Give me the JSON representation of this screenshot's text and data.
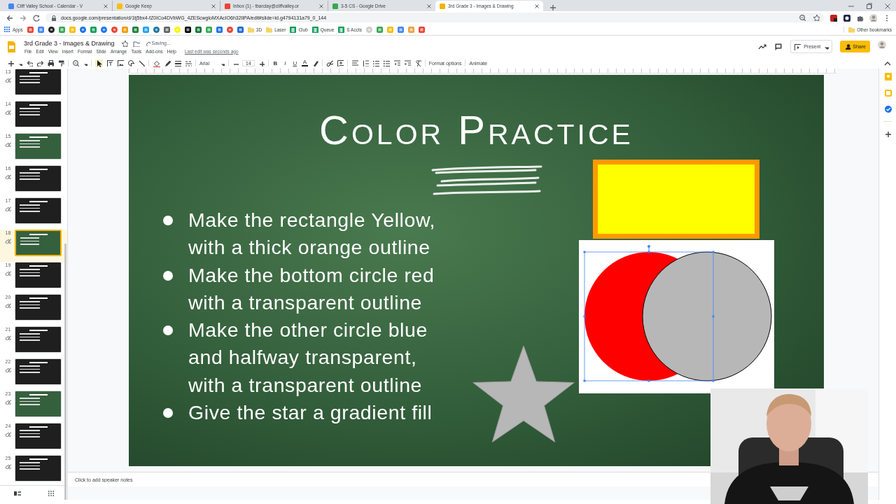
{
  "browser": {
    "tabs": [
      {
        "title": "Cliff Valley School - Calendar - V",
        "selected": false,
        "color": "#4285f4"
      },
      {
        "title": "Google Keep",
        "selected": false,
        "color": "#fbbc04"
      },
      {
        "title": "Inbox (1) - tbarclay@cliffvalley.or",
        "selected": false,
        "color": "#ea4335"
      },
      {
        "title": "3-5 CS - Google Drive",
        "selected": false,
        "color": "#34a853"
      },
      {
        "title": "3rd Grade 3 - Images & Drawing",
        "selected": true,
        "color": "#f4b400"
      }
    ],
    "address": "docs.google.com/presentation/d/1tj5bx4-fZ0ICo4DVbWG_4ZEScwgloMXAcIO6h32lIPA/edit#slide=id.g4794131a79_0_144",
    "bookmarks": [
      {
        "kind": "apps",
        "label": "Apps",
        "color": "#4285f4"
      },
      {
        "kind": "site",
        "color": "#ea4335"
      },
      {
        "kind": "site",
        "color": "#4285f4"
      },
      {
        "kind": "round",
        "color": "#202124"
      },
      {
        "kind": "site",
        "color": "#34a853"
      },
      {
        "kind": "site",
        "color": "#fbbc04"
      },
      {
        "kind": "round",
        "color": "#1a73e8"
      },
      {
        "kind": "site",
        "color": "#0f9d58"
      },
      {
        "kind": "round",
        "color": "#1877f2"
      },
      {
        "kind": "round",
        "color": "#ea4335"
      },
      {
        "kind": "site",
        "color": "#f29900"
      },
      {
        "kind": "site",
        "color": "#188038"
      },
      {
        "kind": "site",
        "color": "#1da1f2"
      },
      {
        "kind": "round",
        "color": "#21759b"
      },
      {
        "kind": "site",
        "color": "#5f6368"
      },
      {
        "kind": "round",
        "color": "#fff200"
      },
      {
        "kind": "site",
        "color": "#000000"
      },
      {
        "kind": "site",
        "color": "#137333"
      },
      {
        "kind": "site",
        "color": "#34a853"
      },
      {
        "kind": "site",
        "color": "#1a73e8"
      },
      {
        "kind": "round",
        "color": "#ea4335"
      },
      {
        "kind": "site",
        "color": "#1967d2"
      },
      {
        "kind": "folder",
        "label": "3D",
        "color": "#f6d365"
      },
      {
        "kind": "folder",
        "label": "Laser",
        "color": "#f6d365"
      },
      {
        "kind": "sheet",
        "label": "Club",
        "color": "#0f9d58"
      },
      {
        "kind": "sheet",
        "label": "Queue",
        "color": "#0f9d58"
      },
      {
        "kind": "sheet",
        "label": "S Accts",
        "color": "#0f9d58"
      },
      {
        "kind": "round",
        "color": "#cccccc"
      },
      {
        "kind": "site",
        "color": "#34a853"
      },
      {
        "kind": "site",
        "color": "#fbbc04"
      },
      {
        "kind": "site",
        "color": "#4285f4"
      },
      {
        "kind": "site",
        "color": "#e8a33d"
      },
      {
        "kind": "site",
        "color": "#ea4335"
      }
    ],
    "other_bookmarks": "Other bookmarks"
  },
  "document": {
    "title": "3rd Grade 3 - Images & Drawing",
    "status": "Saving...",
    "menus": [
      "File",
      "Edit",
      "View",
      "Insert",
      "Format",
      "Slide",
      "Arrange",
      "Tools",
      "Add-ons",
      "Help"
    ],
    "last_edit": "Last edit was seconds ago",
    "present": "Present",
    "share": "Share"
  },
  "toolbar": {
    "font": "Arial",
    "font_size": "14",
    "format_buttons": [
      "B",
      "I",
      "U",
      "A"
    ],
    "format_options": "Format options",
    "animate": "Animate"
  },
  "slides_panel": {
    "slides": [
      {
        "number": "13",
        "kind": "dark",
        "selected": false
      },
      {
        "number": "14",
        "kind": "dark",
        "selected": false
      },
      {
        "number": "15",
        "kind": "green",
        "selected": false
      },
      {
        "number": "16",
        "kind": "dark",
        "selected": false
      },
      {
        "number": "17",
        "kind": "dark",
        "selected": false
      },
      {
        "number": "18",
        "kind": "green",
        "selected": true
      },
      {
        "number": "19",
        "kind": "dark",
        "selected": false
      },
      {
        "number": "20",
        "kind": "dark",
        "selected": false
      },
      {
        "number": "21",
        "kind": "dark",
        "selected": false
      },
      {
        "number": "22",
        "kind": "dark",
        "selected": false
      },
      {
        "number": "23",
        "kind": "green",
        "selected": false
      },
      {
        "number": "24",
        "kind": "dark",
        "selected": false
      },
      {
        "number": "25",
        "kind": "dark",
        "selected": false
      }
    ]
  },
  "slide": {
    "title": "Color Practice",
    "bullets": [
      "Make the rectangle Yellow,\nwith a thick orange outline",
      "Make the bottom circle red\nwith a transparent outline",
      " Make the other circle blue\nand halfway transparent,\nwith a transparent outline",
      "Give the star a gradient fill"
    ],
    "shapes": [
      {
        "kind": "rectangle",
        "color": "#ffff00",
        "selected": false
      },
      {
        "kind": "circle",
        "color": "#ff0000",
        "selected": true
      },
      {
        "kind": "circle",
        "color": "#b7b7b7",
        "selected": false
      },
      {
        "kind": "star",
        "color": "#b7b7b7",
        "selected": false
      }
    ]
  },
  "speaker_notes": {
    "placeholder": "Click to add speaker notes"
  }
}
